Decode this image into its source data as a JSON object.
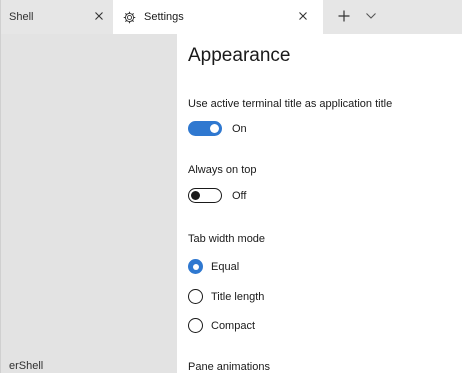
{
  "tabs": [
    {
      "label": "Shell",
      "active": false,
      "close_icon": "close-icon"
    },
    {
      "label": "Settings",
      "active": true,
      "icon": "gear-icon",
      "close_icon": "close-icon"
    }
  ],
  "tabbar": {
    "new_tab_icon": "plus-icon",
    "dropdown_icon": "chevron-down-icon"
  },
  "left_pane": {
    "label": "erShell"
  },
  "settings": {
    "page_title": "Appearance",
    "active_title": {
      "label": "Use active terminal title as application title",
      "state_text": "On",
      "value": true
    },
    "always_on_top": {
      "label": "Always on top",
      "state_text": "Off",
      "value": false
    },
    "tab_width_mode": {
      "label": "Tab width mode",
      "options": [
        "Equal",
        "Title length",
        "Compact"
      ],
      "selected": "Equal"
    },
    "pane_animations": {
      "label": "Pane animations"
    }
  },
  "colors": {
    "accent": "#2f78d0",
    "tabbar_bg": "#e6e6e6",
    "pane_bg": "#e3e3e3"
  }
}
